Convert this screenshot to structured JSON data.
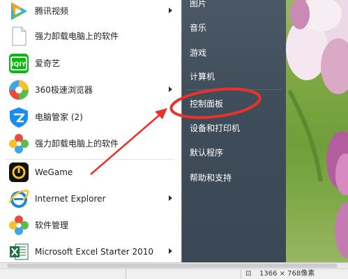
{
  "start_menu": {
    "programs": [
      {
        "label": "腾讯视频",
        "icon": "tencent-video-icon",
        "has_arrow": true
      },
      {
        "label": "强力卸载电脑上的软件",
        "icon": "document-icon",
        "has_arrow": false
      },
      {
        "label": "爱奇艺",
        "icon": "iqiyi-icon",
        "has_arrow": false
      },
      {
        "label": "360极速浏览器",
        "icon": "browser-360-icon",
        "has_arrow": true
      },
      {
        "label": "电脑管家 (2)",
        "icon": "pc-manager-icon",
        "has_arrow": false
      },
      {
        "label": "强力卸载电脑上的软件",
        "icon": "uninstaller-icon",
        "has_arrow": false
      },
      {
        "label": "WeGame",
        "icon": "wegame-icon",
        "has_arrow": false
      },
      {
        "label": "Internet Explorer",
        "icon": "ie-icon",
        "has_arrow": true
      },
      {
        "label": "软件管理",
        "icon": "software-manager-icon",
        "has_arrow": false
      },
      {
        "label": "Microsoft Excel Starter 2010",
        "icon": "excel-icon",
        "has_arrow": true
      }
    ],
    "system_items": [
      {
        "label": "图片"
      },
      {
        "label": "音乐"
      },
      {
        "label": "游戏"
      },
      {
        "label": "计算机"
      },
      {
        "label": "控制面板"
      },
      {
        "label": "设备和打印机"
      },
      {
        "label": "默认程序"
      },
      {
        "label": "帮助和支持"
      }
    ]
  },
  "status_bar": {
    "resolution": "1366 × 768像素"
  },
  "colors": {
    "annotation": "#e8332a",
    "right_panel": "#44525f"
  }
}
